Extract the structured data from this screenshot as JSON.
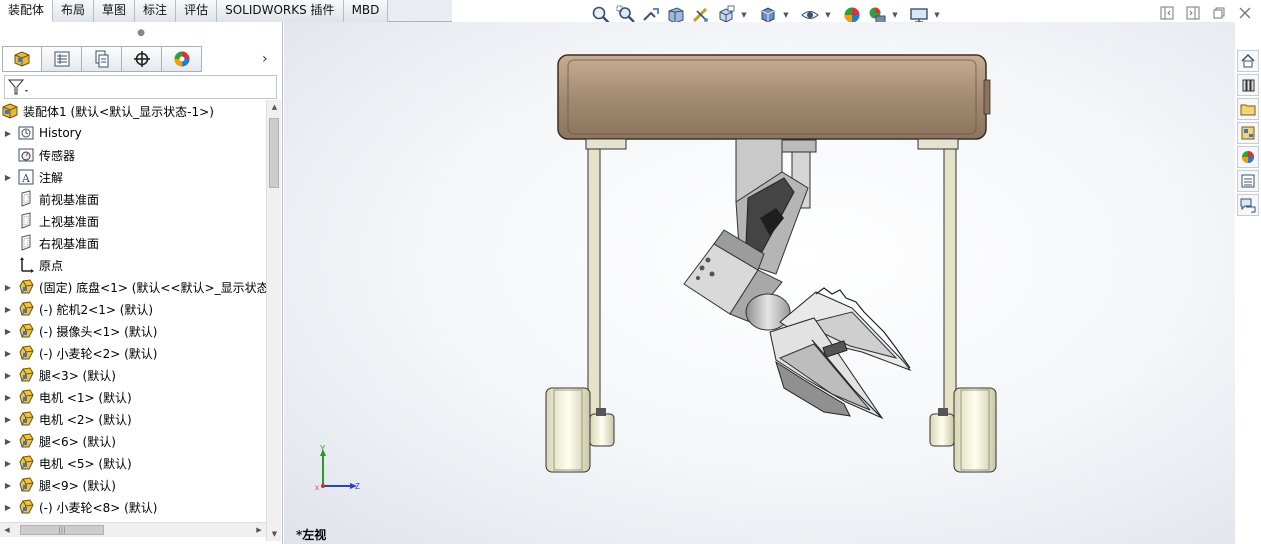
{
  "tabs": [
    {
      "label": "装配体",
      "active": true
    },
    {
      "label": "布局"
    },
    {
      "label": "草图"
    },
    {
      "label": "标注"
    },
    {
      "label": "评估"
    },
    {
      "label": "SOLIDWORKS 插件"
    },
    {
      "label": "MBD"
    }
  ],
  "hud_icons": [
    "zoom-to-fit-icon",
    "zoom-to-area-icon",
    "previous-view-icon",
    "section-view-icon",
    "dynamic-annotation-icon",
    "view-orientation-icon",
    "display-style-icon",
    "hide-show-items-icon",
    "edit-appearance-icon",
    "apply-scene-icon",
    "view-settings-icon"
  ],
  "panel_tabs": [
    "featuremanager-icon",
    "propertymanager-icon",
    "configurationmanager-icon",
    "dimxpertmanager-icon",
    "displaymanager-icon"
  ],
  "tree": {
    "root": "装配体1  (默认<默认_显示状态-1>)",
    "items": [
      {
        "label": "History",
        "icon": "history-icon",
        "expand": true
      },
      {
        "label": "传感器",
        "icon": "sensor-icon",
        "expand": false
      },
      {
        "label": "注解",
        "icon": "annotation-icon",
        "expand": true
      },
      {
        "label": "前视基准面",
        "icon": "plane-icon",
        "expand": false
      },
      {
        "label": "上视基准面",
        "icon": "plane-icon",
        "expand": false
      },
      {
        "label": "右视基准面",
        "icon": "plane-icon",
        "expand": false
      },
      {
        "label": "原点",
        "icon": "origin-icon",
        "expand": false
      },
      {
        "label": "(固定) 底盘<1> (默认<<默认>_显示状态",
        "icon": "part-icon",
        "expand": true
      },
      {
        "label": "(-) 舵机2<1> (默认)",
        "icon": "part-icon",
        "expand": true
      },
      {
        "label": "(-) 摄像头<1> (默认)",
        "icon": "part-icon",
        "expand": true
      },
      {
        "label": "(-) 小麦轮<2> (默认)",
        "icon": "part-icon",
        "expand": true
      },
      {
        "label": "腿<3> (默认)",
        "icon": "part-icon",
        "expand": true
      },
      {
        "label": "电机 <1> (默认)",
        "icon": "part-icon",
        "expand": true
      },
      {
        "label": "电机 <2> (默认)",
        "icon": "part-icon",
        "expand": true
      },
      {
        "label": "腿<6> (默认)",
        "icon": "part-icon",
        "expand": true
      },
      {
        "label": "电机 <5> (默认)",
        "icon": "part-icon",
        "expand": true
      },
      {
        "label": "腿<9> (默认)",
        "icon": "part-icon",
        "expand": true
      },
      {
        "label": "(-) 小麦轮<8> (默认)",
        "icon": "part-icon",
        "expand": true
      }
    ]
  },
  "viewport": {
    "view_label": "*左视",
    "triad": {
      "y": "Y",
      "z": "Z",
      "x": "X"
    }
  },
  "taskpane": [
    "home-icon",
    "design-library-icon",
    "file-explorer-icon",
    "view-palette-icon",
    "appearances-icon",
    "custom-properties-icon",
    "forum-icon"
  ],
  "colors": {
    "body_top": "#a48b73",
    "axis_y": "#2b9a2b",
    "axis_z": "#2b3fd0",
    "axis_x": "#d02b2b"
  }
}
